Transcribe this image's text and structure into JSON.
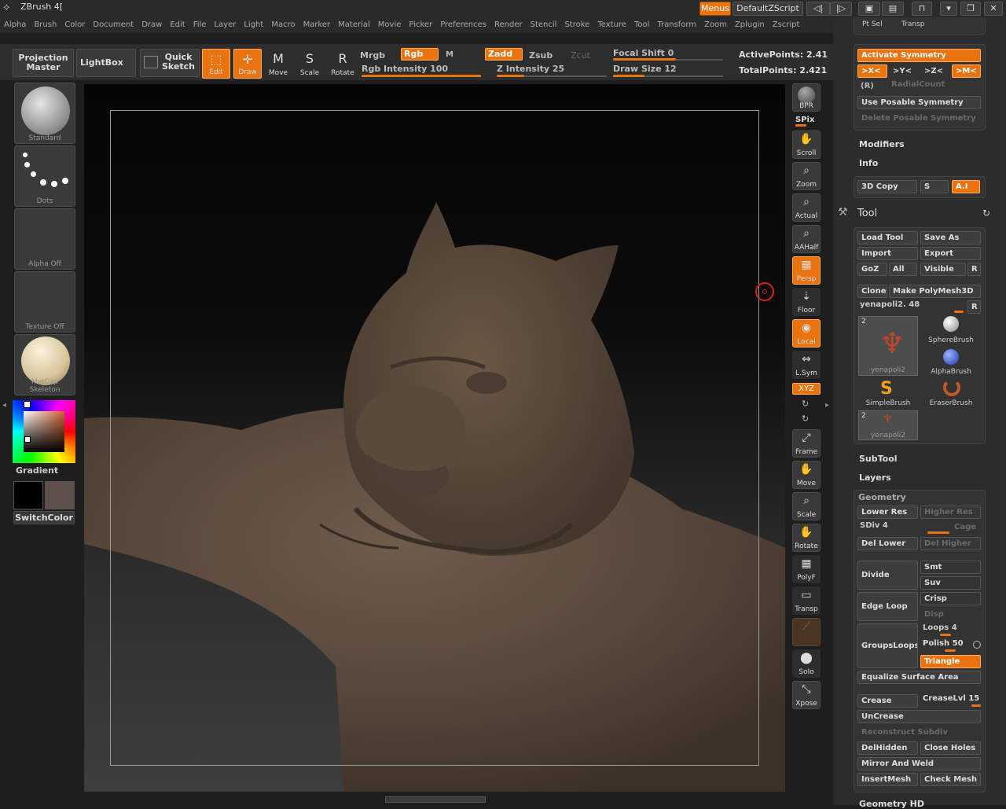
{
  "app": {
    "title": "ZBrush 4["
  },
  "titlebar": {
    "menus_label": "Menus",
    "script_label": "DefaultZScript"
  },
  "menubar": [
    "Alpha",
    "Brush",
    "Color",
    "Document",
    "Draw",
    "Edit",
    "File",
    "Layer",
    "Light",
    "Macro",
    "Marker",
    "Material",
    "Movie",
    "Picker",
    "Preferences",
    "Render",
    "Stencil",
    "Stroke",
    "Texture",
    "Tool",
    "Transform",
    "Zoom",
    "Zplugin",
    "Zscript"
  ],
  "toolbar": {
    "projection_master": "Projection Master",
    "lightbox": "LightBox",
    "quick_sketch": "Quick Sketch",
    "edit": "Edit",
    "draw": "Draw",
    "move": "Move",
    "scale": "Scale",
    "rotate": "Rotate",
    "mrgb": "Mrgb",
    "rgb": "Rgb",
    "m": "M",
    "zadd": "Zadd",
    "zsub": "Zsub",
    "zcut": "Zcut",
    "rgb_intensity": "Rgb Intensity 100",
    "z_intensity": "Z Intensity 25",
    "focal_shift": "Focal Shift 0",
    "draw_size": "Draw Size 12",
    "active_points": "ActivePoints: 2.41",
    "total_points": "TotalPoints: 2.421",
    "rgb_intensity_value": 100,
    "z_intensity_value": 25,
    "draw_size_value": 12
  },
  "left_shelf": {
    "brush": "Standard",
    "stroke": "Dots",
    "alpha": "Alpha Off",
    "texture": "Texture Off",
    "material": "MatCap Skeleton",
    "gradient_label": "Gradient",
    "switch_color": "SwitchColor"
  },
  "right_shelf": [
    {
      "name": "bpr",
      "label": "BPR"
    },
    {
      "name": "spix",
      "label": "SPix"
    },
    {
      "name": "scroll",
      "label": "Scroll"
    },
    {
      "name": "zoom",
      "label": "Zoom"
    },
    {
      "name": "actual",
      "label": "Actual"
    },
    {
      "name": "aahalf",
      "label": "AAHalf"
    },
    {
      "name": "persp",
      "label": "Persp"
    },
    {
      "name": "floor",
      "label": "Floor"
    },
    {
      "name": "local",
      "label": "Local"
    },
    {
      "name": "lsym",
      "label": "L.Sym"
    },
    {
      "name": "xyz",
      "label": "XYZ"
    },
    {
      "name": "frame",
      "label": "Frame"
    },
    {
      "name": "move",
      "label": "Move"
    },
    {
      "name": "scale",
      "label": "Scale"
    },
    {
      "name": "rotate",
      "label": "Rotate"
    },
    {
      "name": "polyf",
      "label": "PolyF"
    },
    {
      "name": "transp",
      "label": "Transp"
    },
    {
      "name": "solo",
      "label": "Solo"
    },
    {
      "name": "xpose",
      "label": "Xpose"
    }
  ],
  "panel": {
    "top_items": [
      "Pt Sel",
      "Transp"
    ],
    "symmetry": {
      "activate": "Activate Symmetry",
      "x": ">X<",
      "y": ">Y<",
      "z": ">Z<",
      "m": ">M<",
      "r": "(R)",
      "radial_count": "RadialCount",
      "use_posable": "Use Posable Symmetry",
      "delete_posable": "Delete Posable Symmetry"
    },
    "modifiers": "Modifiers",
    "info": "Info",
    "copy3d": "3D Copy",
    "s": "S",
    "ai": "A.I",
    "tool_title": "Tool",
    "load_tool": "Load Tool",
    "save_as": "Save As",
    "import": "Import",
    "export": "Export",
    "goz": "GoZ",
    "all": "All",
    "visible": "Visible",
    "r": "R",
    "clone": "Clone",
    "make_polymesh": "Make PolyMesh3D",
    "current_tool": "yenapoli2. 48",
    "tools": [
      {
        "name": "yenapoli2",
        "count": "2"
      },
      {
        "name": "SphereBrush",
        "count": ""
      },
      {
        "name": "AlphaBrush",
        "count": ""
      },
      {
        "name": "SimpleBrush",
        "count": ""
      },
      {
        "name": "EraserBrush",
        "count": ""
      },
      {
        "name": "yenapoli2",
        "count": "2"
      }
    ],
    "subtool": "SubTool",
    "layers": "Layers",
    "geometry": "Geometry",
    "lower_res": "Lower Res",
    "higher_res": "Higher Res",
    "sdiv": "SDiv 4",
    "cage": "Cage",
    "del_lower": "Del Lower",
    "del_higher": "Del Higher",
    "divide": "Divide",
    "smt": "Smt",
    "suv": "Suv",
    "edge_loop": "Edge Loop",
    "crisp": "Crisp",
    "disp": "Disp",
    "groups_loops": "GroupsLoops",
    "loops": "Loops 4",
    "polish": "Polish 50",
    "triangle": "Triangle",
    "equalize": "Equalize Surface Area",
    "crease": "Crease",
    "crease_lvl": "CreaseLvl 15",
    "uncrease": "UnCrease",
    "reconstruct": "Reconstruct Subdiv",
    "del_hidden": "DelHidden",
    "close_holes": "Close Holes",
    "mirror_weld": "Mirror And Weld",
    "insert_mesh": "InsertMesh",
    "check_mesh": "Check Mesh",
    "geometry_hd": "Geometry HD"
  },
  "colors": {
    "accent": "#e8730f",
    "panel": "#2c2c2c",
    "sculpt": "#5a4a3c"
  }
}
